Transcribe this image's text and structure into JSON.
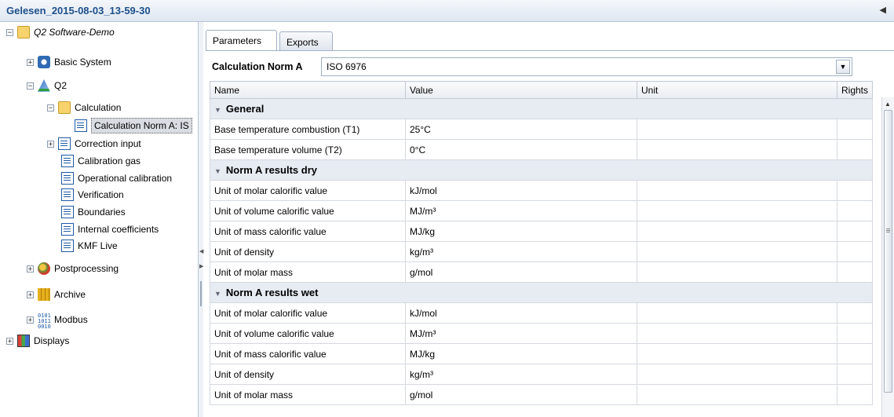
{
  "window": {
    "title": "Gelesen_2015-08-03_13-59-30"
  },
  "tree": {
    "root": "Q2 Software-Demo",
    "basic_system": "Basic System",
    "q2": "Q2",
    "calculation": "Calculation",
    "calc_norm": "Calculation Norm A: IS",
    "correction_input": "Correction input",
    "calibration_gas": "Calibration gas",
    "operational_calibration": "Operational calibration",
    "verification": "Verification",
    "boundaries": "Boundaries",
    "internal_coefficients": "Internal coefficients",
    "kmf_live": "KMF Live",
    "postprocessing": "Postprocessing",
    "archive": "Archive",
    "modbus": "Modbus",
    "displays": "Displays"
  },
  "tabs": [
    "Parameters",
    "Exports"
  ],
  "norm": {
    "label": "Calculation Norm A",
    "value": "ISO 6976"
  },
  "grid": {
    "columns": [
      "Name",
      "Value",
      "Unit",
      "Rights"
    ],
    "groups": [
      {
        "title": "General",
        "rows": [
          [
            "Base temperature combustion (T1)",
            "25°C"
          ],
          [
            "Base temperature volume (T2)",
            "0°C"
          ]
        ]
      },
      {
        "title": "Norm A results dry",
        "rows": [
          [
            "Unit of molar calorific value",
            "kJ/mol"
          ],
          [
            "Unit of volume calorific value",
            "MJ/m³"
          ],
          [
            "Unit of mass calorific value",
            "MJ/kg"
          ],
          [
            "Unit of density",
            "kg/m³"
          ],
          [
            "Unit of molar mass",
            "g/mol"
          ]
        ]
      },
      {
        "title": "Norm A results wet",
        "rows": [
          [
            "Unit of molar calorific value",
            "kJ/mol"
          ],
          [
            "Unit of volume calorific value",
            "MJ/m³"
          ],
          [
            "Unit of mass calorific value",
            "MJ/kg"
          ],
          [
            "Unit of density",
            "kg/m³"
          ],
          [
            "Unit of molar mass",
            "g/mol"
          ]
        ]
      }
    ]
  }
}
